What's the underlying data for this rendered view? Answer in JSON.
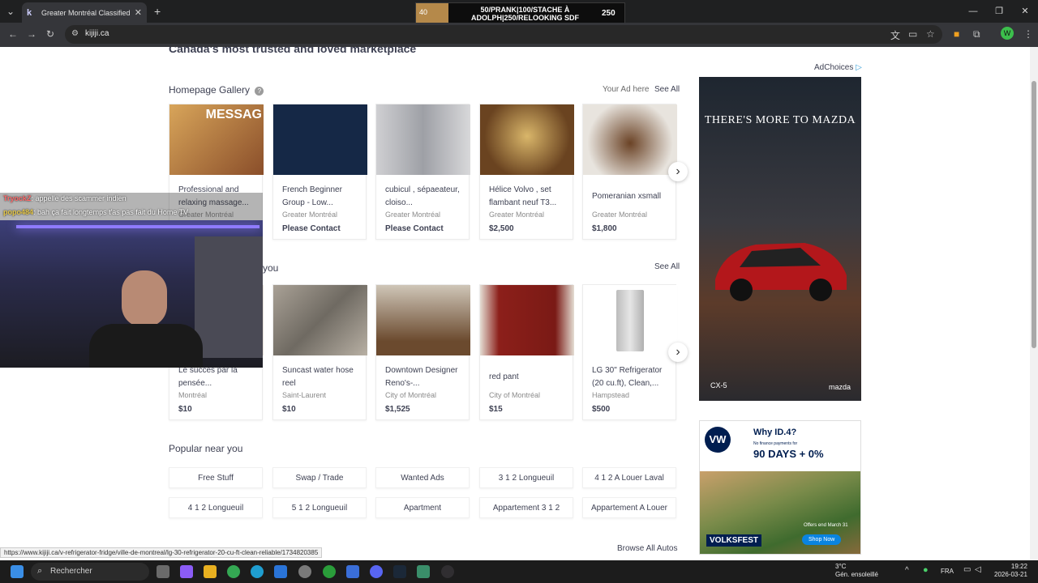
{
  "browser": {
    "tab_title": "Greater Montréal Classifieds - ",
    "tab_favicon": "k",
    "url": "kijiji.ca",
    "status_url": "https://www.kijiji.ca/v-refrigerator-fridge/ville-de-montreal/lg-30-refrigerator-20-cu-ft-clean-reliable/1734820385"
  },
  "stream_banner": {
    "left_value": "40",
    "text": "50/PRANK|100/STACHE À ADOLPH|250/RELOOKING SDF",
    "right_value": "250"
  },
  "page": {
    "headline": "Canada's most trusted and loved marketplace",
    "gallery": {
      "title": "Homepage Gallery",
      "your_ad": "Your Ad here",
      "see_all": "See All",
      "cards": [
        {
          "title": "Professional and relaxing massage...",
          "location": "Greater Montréal",
          "price": "",
          "image_text": "MESSAG"
        },
        {
          "title": "French Beginner Group - Low...",
          "location": "Greater Montréal",
          "price": "Please Contact",
          "image_text": ""
        },
        {
          "title": "cubicul , sépaeateur, cloiso...",
          "location": "Greater Montréal",
          "price": "Please Contact",
          "image_text": ""
        },
        {
          "title": "Hélice Volvo , set flambant neuf T3...",
          "location": "Greater Montréal",
          "price": "$2,500",
          "image_text": ""
        },
        {
          "title": "Pomeranian xsmall",
          "location": "Greater Montréal",
          "price": "$1,800",
          "image_text": ""
        }
      ]
    },
    "recommended": {
      "title": "you",
      "see_all": "See All",
      "cards": [
        {
          "title": "Le succès par la pensée...",
          "location": "Montréal",
          "price": "$10"
        },
        {
          "title": "Suncast water hose reel",
          "location": "Saint-Laurent",
          "price": "$10"
        },
        {
          "title": "Downtown Designer Reno's-...",
          "location": "City of Montréal",
          "price": "$1,525"
        },
        {
          "title": "red pant",
          "location": "City of Montréal",
          "price": "$15"
        },
        {
          "title": "LG 30\" Refrigerator (20 cu.ft), Clean,...",
          "location": "Hampstead",
          "price": "$500"
        }
      ]
    },
    "popular": {
      "title": "Popular near you",
      "items": [
        "Free Stuff",
        "Swap / Trade",
        "Wanted Ads",
        "3 1 2 Longueuil",
        "4 1 2 A Louer Laval",
        "4 1 2 Longueuil",
        "5 1 2 Longueuil",
        "Apartment",
        "Appartement 3 1 2",
        "Appartement A Louer"
      ]
    },
    "browse_autos": "Browse All Autos",
    "ads": {
      "adchoices": "AdChoices",
      "mazda_text": "THERE'S MORE TO MAZDA",
      "mazda_model": "CX-5",
      "mazda_brand": "mazda",
      "vw_title": "Why ID.4?",
      "vw_fine": "No finance payments for",
      "vw_big": "90 DAYS + 0%",
      "vw_offer": "Offers end March 31",
      "vw_fest": "VOLKSFEST",
      "vw_shop": "Shop Now"
    }
  },
  "chat": [
    {
      "user": "TryockZ",
      "message": ": appelle des scammer indien",
      "color": "#ff6a6a"
    },
    {
      "user": "popo484",
      "message": ": bah ça fait longtemps t'as pas fait du Home TV",
      "color": "#e6c84a"
    }
  ],
  "taskbar": {
    "search": "Rechercher",
    "weather_temp": "3°C",
    "weather_desc": "Gén. ensoleillé",
    "lang": "FRA",
    "time": "19:22",
    "date": "2026-03-21"
  },
  "colors": {
    "accent_text": "#3e4153",
    "chrome_dark": "#1f2021",
    "page_bg": "#ffffff"
  }
}
